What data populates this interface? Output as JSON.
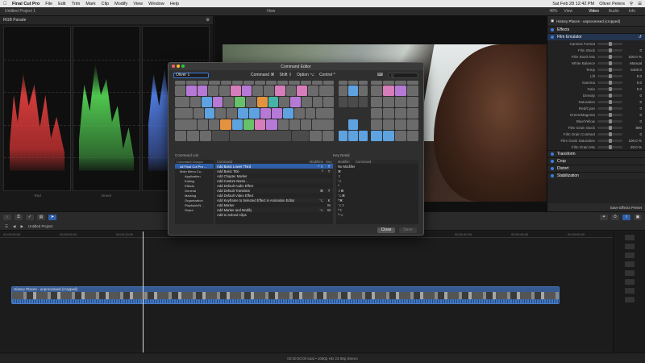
{
  "menubar": {
    "app": "Final Cut Pro",
    "items": [
      "File",
      "Edit",
      "Trim",
      "Mark",
      "Clip",
      "Modify",
      "View",
      "Window",
      "Help"
    ],
    "clock": "Sat Feb 28 12:42 PM",
    "user": "Oliver Peters"
  },
  "toolbar": {
    "project": "Untitled Project 1",
    "view_label": "View",
    "zoom": "48%",
    "viewer_view": "View",
    "tabs": [
      "Video",
      "Audio",
      "Info"
    ]
  },
  "scopes": {
    "title": "RGB Parade",
    "labels": [
      "Red",
      "Green",
      "Blue"
    ]
  },
  "inspector": {
    "clip_name": "History Places - unprocessed (cropped)",
    "effects_label": "Effects",
    "effect_name": "Film Emulator",
    "rows": [
      {
        "label": "Camera Format",
        "value": ""
      },
      {
        "label": "Film Stock",
        "value": "0"
      },
      {
        "label": "Film Stock Mix",
        "value": "100.0 %"
      },
      {
        "label": "White Balance",
        "value": "Manual"
      },
      {
        "label": "Temp",
        "value": "5400.0"
      },
      {
        "label": "Lift",
        "value": "0.0"
      },
      {
        "label": "Gamma",
        "value": "0.0"
      },
      {
        "label": "Gain",
        "value": "0.0"
      },
      {
        "label": "Density",
        "value": "0"
      },
      {
        "label": "Saturation",
        "value": "0"
      },
      {
        "label": "Red/Cyan",
        "value": "0"
      },
      {
        "label": "Green/Magenta",
        "value": "0"
      },
      {
        "label": "Blue/Yellow",
        "value": "0"
      },
      {
        "label": "Film Grain Stock",
        "value": "800"
      },
      {
        "label": "Film Grain Contrast",
        "value": "0"
      },
      {
        "label": "Film Grain Saturation",
        "value": "100.0 %"
      },
      {
        "label": "Film Grain Mix",
        "value": "20.0 %"
      }
    ],
    "sections": [
      "Transform",
      "Crop",
      "Distort",
      "Stabilization"
    ],
    "footer": "Save Effects Preset"
  },
  "dialog": {
    "title": "Command Editor",
    "preset": "Oliver 1",
    "modifiers": [
      "Command ⌘",
      "Shift ⇧",
      "Option ⌥",
      "Control ^"
    ],
    "search_placeholder": "Q",
    "command_list_title": "Command List",
    "key_detail_title": "Key Detail",
    "groups_header": "Command Groups",
    "groups": [
      "All Final Cut Pro ...",
      "Main Menu Co...",
      "Application",
      "Editing",
      "Effects",
      "General",
      "Marking",
      "Organization",
      "Playback/N...",
      "Share"
    ],
    "group_counts": [
      "",
      "",
      "",
      "",
      "",
      "",
      "",
      "",
      "",
      ""
    ],
    "table_headers": {
      "command": "Command",
      "modifiers": "Modifiers",
      "key": "Key"
    },
    "commands": [
      {
        "name": "Add Basic Lower Third",
        "mod": "^ ⇧",
        "key": "T"
      },
      {
        "name": "Add Basic Title",
        "mod": "^",
        "key": "T"
      },
      {
        "name": "Add Chapter Marker",
        "mod": "",
        "key": ""
      },
      {
        "name": "Add Custom Name...",
        "mod": "",
        "key": ""
      },
      {
        "name": "Add Default Audio Effect",
        "mod": "",
        "key": ""
      },
      {
        "name": "Add Default Transition",
        "mod": "⌘",
        "key": "T"
      },
      {
        "name": "Add Default Video Effect",
        "mod": "",
        "key": ""
      },
      {
        "name": "Add Keyframe to Selected Effect in Animation Editor",
        "mod": "⌥",
        "key": "K"
      },
      {
        "name": "Add Marker",
        "mod": "",
        "key": "M"
      },
      {
        "name": "Add Marker and Modify",
        "mod": "⌥",
        "key": "M"
      },
      {
        "name": "Add to Soloed Clips",
        "mod": "",
        "key": ""
      }
    ],
    "detail_headers": {
      "modifier": "Modifier",
      "command": "Command"
    },
    "detail_rows": [
      {
        "mod": "No Modifier",
        "cmd": ""
      },
      {
        "mod": "⌘",
        "cmd": ""
      },
      {
        "mod": "⇧",
        "cmd": ""
      },
      {
        "mod": "⌥",
        "cmd": ""
      },
      {
        "mod": "^",
        "cmd": ""
      },
      {
        "mod": "⇧⌘",
        "cmd": ""
      },
      {
        "mod": "⌥⌘",
        "cmd": ""
      },
      {
        "mod": "^⌘",
        "cmd": ""
      },
      {
        "mod": "⌥⇧",
        "cmd": ""
      },
      {
        "mod": "^⇧",
        "cmd": ""
      },
      {
        "mod": "^⌥",
        "cmd": ""
      }
    ],
    "close_label": "Close",
    "save_label": "Save"
  },
  "timeline": {
    "project_name": "Untitled Project",
    "clip_name": "History Places - unprocessed (cropped)",
    "status": "00:00:00:00 total • 1080p HD 23.98p Stereo",
    "ruler": [
      "00:00:00:00",
      "00:00:05:00",
      "00:00:10:00",
      "00:00:15:00",
      "00:00:20:00",
      "00:00:25:00",
      "00:00:30:00",
      "00:00:35:00",
      "00:00:40:00",
      "00:00:45:00",
      "00:00:50:00"
    ]
  },
  "colors": {
    "accent": "#2f5fa8",
    "clip": "#2a4a77",
    "purple_key": "#b679d6",
    "blue_key": "#5ea2e0",
    "green_key": "#67c16a",
    "orange_key": "#e3933f"
  }
}
